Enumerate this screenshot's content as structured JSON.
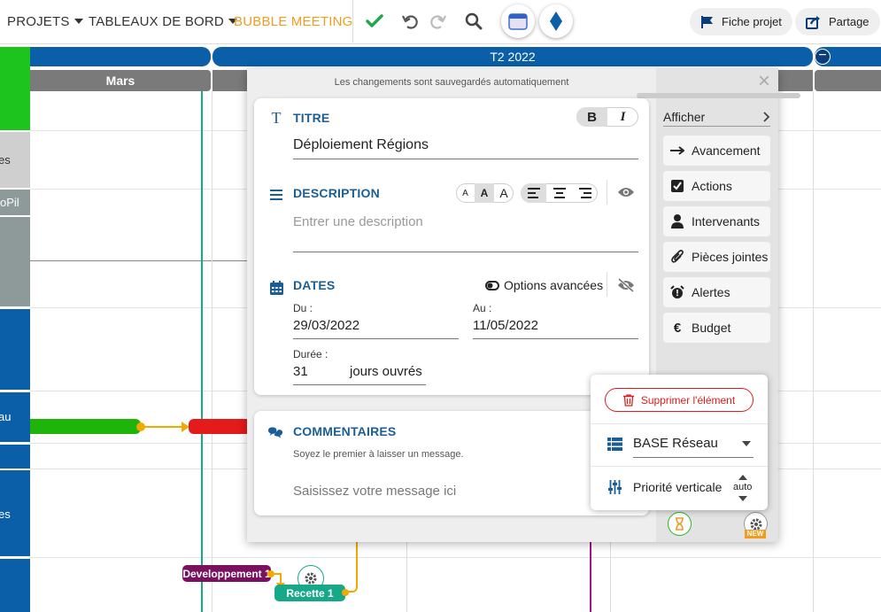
{
  "toolbar": {
    "projets": "PROJETS",
    "tableaux": "TABLEAUX DE BORD",
    "bubble": "BUBBLE MEETING",
    "fiche_projet": "Fiche projet",
    "partage": "Partage",
    "icons": [
      "check-icon",
      "undo-icon",
      "redo-icon",
      "search-icon",
      "calendar-icon",
      "diamond-icon",
      "flag-icon",
      "share-icon"
    ],
    "accent_color": "#f29c1f"
  },
  "gantt": {
    "quarter": "T2 2022",
    "month": "Mars",
    "left_labels": [
      "es",
      "oPil",
      "au",
      "es"
    ],
    "tasks": {
      "dev": "Developpement 1",
      "recette": "Recette 1"
    }
  },
  "modal": {
    "autosave": "Les changements sont sauvegardés automatiquement",
    "titre_label": "TITRE",
    "titre_value": "Déploiement Régions",
    "bold": "B",
    "italic": "I",
    "description_label": "DESCRIPTION",
    "description_placeholder": "Entrer une description",
    "size_buttons": [
      "A",
      "A",
      "A"
    ],
    "dates_label": "DATES",
    "options_avancees": "Options avancées",
    "du_label": "Du :",
    "du_value": "29/03/2022",
    "au_label": "Au :",
    "au_value": "11/05/2022",
    "duree_label": "Durée :",
    "duree_value": "31",
    "duree_unit": "jours ouvrés",
    "commentaires_label": "COMMENTAIRES",
    "commentaires_hint": "Soyez le premier à laisser un message.",
    "message_placeholder": "Saisissez votre message ici",
    "close": "×"
  },
  "side_panel": {
    "afficher": "Afficher",
    "items": [
      {
        "label": "Avancement",
        "icon": "arrow-right-icon"
      },
      {
        "label": "Actions",
        "icon": "checkbox-icon"
      },
      {
        "label": "Intervenants",
        "icon": "user-icon"
      },
      {
        "label": "Pièces jointes",
        "icon": "paperclip-icon"
      },
      {
        "label": "Alertes",
        "icon": "alarm-icon"
      },
      {
        "label": "Budget",
        "icon": "euro-icon"
      }
    ],
    "new_badge": "NEW"
  },
  "popover": {
    "delete": "Supprimer l'élément",
    "base": "BASE Réseau",
    "priorite": "Priorité verticale",
    "auto": "auto"
  },
  "colors": {
    "blue": "#0a5fa8",
    "title_blue": "#1a5e98",
    "green": "#1fb40a",
    "red": "#e31b1b",
    "orange": "#f2a900",
    "purple": "#7a1060",
    "teal": "#17a88a"
  }
}
